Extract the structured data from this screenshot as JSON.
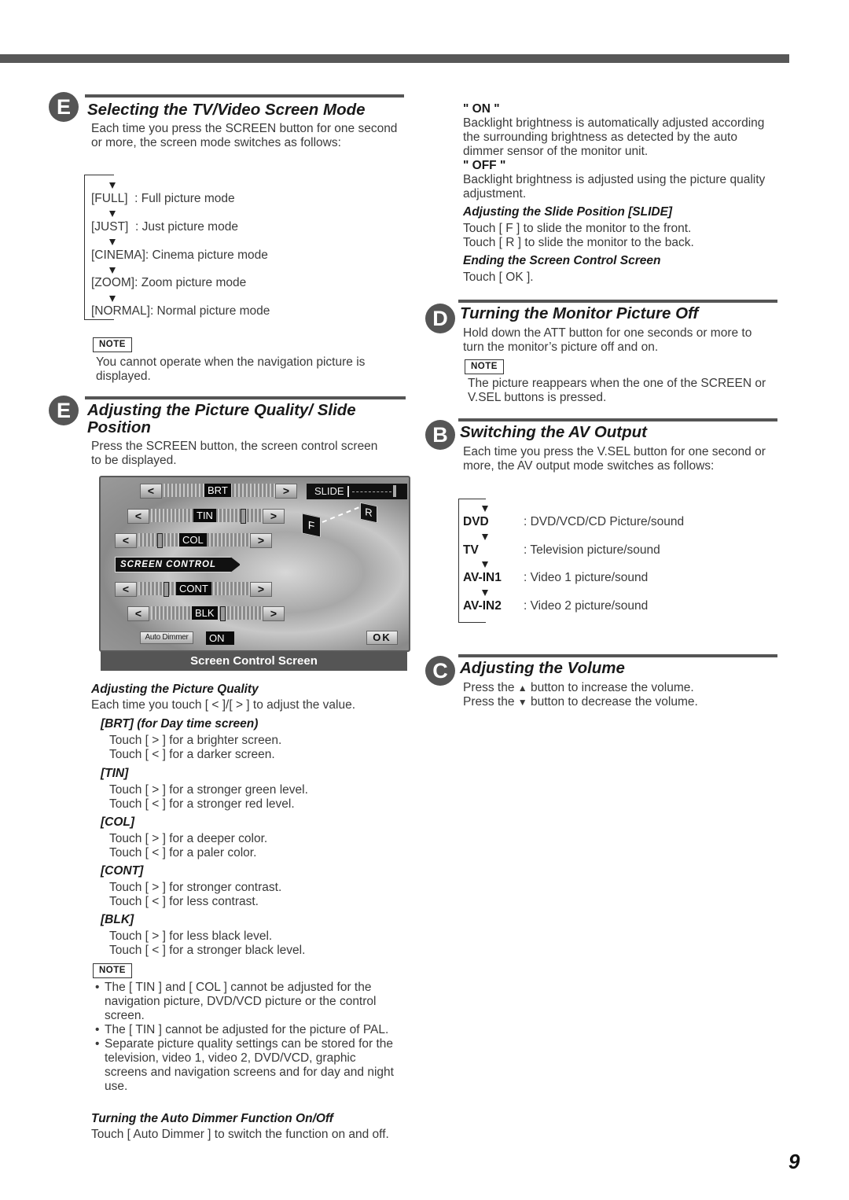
{
  "page_number": "9",
  "left": {
    "section1": {
      "badge": "E",
      "title": "Selecting the TV/Video Screen Mode",
      "intro": "Each time you press the SCREEN button for one second or more, the screen mode switches as follows:",
      "modes": [
        {
          "key": "[FULL]",
          "desc": "  : Full picture mode"
        },
        {
          "key": "[JUST]",
          "desc": "  : Just picture mode"
        },
        {
          "key": "[CINEMA]",
          "desc": ": Cinema picture mode"
        },
        {
          "key": "[ZOOM]",
          "desc": ": Zoom picture mode"
        },
        {
          "key": "[NORMAL]",
          "desc": ": Normal picture mode"
        }
      ],
      "note_label": "NOTE",
      "note_text": "You cannot operate when the navigation picture is displayed."
    },
    "section2": {
      "badge": "E",
      "title_line1": "Adjusting the Picture Quality/ Slide",
      "title_line2": "Position",
      "intro": "Press the SCREEN button, the screen control screen to be displayed.",
      "screen": {
        "rows": [
          {
            "label": "BRT",
            "level": 0.5
          },
          {
            "label": "TIN",
            "level": 0.8
          },
          {
            "label": "COL",
            "level": 0.25
          },
          {
            "label": "CONT",
            "level": 0.35
          },
          {
            "label": "BLK",
            "level": 0.55
          }
        ],
        "less_btn": "<",
        "more_btn": ">",
        "banner": "SCREEN CONTROL",
        "slide_label": "SLIDE",
        "front_btn": "F",
        "rear_btn": "R",
        "auto_dimmer_btn": "Auto Dimmer",
        "auto_dimmer_value": "ON",
        "ok_btn": "OK",
        "caption": "Screen Control Screen"
      },
      "pq_title": "Adjusting the Picture Quality",
      "pq_intro": "Each time you touch [ < ]/[ > ] to adjust the value.",
      "params": [
        {
          "name": "[BRT] (for Day time screen)",
          "lines": [
            "Touch [ > ] for a brighter screen.",
            "Touch [ < ] for a darker screen."
          ]
        },
        {
          "name": "[TIN]",
          "lines": [
            "Touch [ > ] for a stronger green level.",
            "Touch [ < ] for a stronger red level."
          ]
        },
        {
          "name": "[COL]",
          "lines": [
            "Touch [ > ] for a deeper color.",
            "Touch [ < ] for a paler color."
          ]
        },
        {
          "name": "[CONT]",
          "lines": [
            "Touch [ > ] for stronger contrast.",
            "Touch [ < ] for less contrast."
          ]
        },
        {
          "name": "[BLK]",
          "lines": [
            "Touch [ > ] for less black level.",
            "Touch [ < ] for a stronger black level."
          ]
        }
      ],
      "note_label": "NOTE",
      "notes": [
        "The [ TIN ] and [ COL ] cannot be adjusted for the navigation picture, DVD/VCD picture or the control screen.",
        "The [ TIN ] cannot be adjusted for the picture of PAL.",
        "Separate picture quality settings can be stored for the television, video 1, video 2, DVD/VCD, graphic screens and navigation screens and for day and night use."
      ],
      "dimmer_title": "Turning the Auto Dimmer Function On/Off",
      "dimmer_text": "Touch [ Auto Dimmer ] to switch the function on and off."
    }
  },
  "right": {
    "on_label": "\" ON \"",
    "on_text": "Backlight brightness is automatically adjusted according the surrounding brightness as detected by the auto dimmer sensor of the monitor unit.",
    "off_label": "\" OFF \"",
    "off_text": "Backlight brightness is adjusted using the picture quality adjustment.",
    "slide_title": "Adjusting the Slide Position [SLIDE]",
    "slide_lines": [
      "Touch [ F ] to slide the monitor to the front.",
      "Touch [ R ] to slide the monitor to the back."
    ],
    "end_title": "Ending the Screen Control Screen",
    "end_text": "Touch [ OK ].",
    "section_d": {
      "badge": "D",
      "title": "Turning the Monitor Picture Off",
      "text": "Hold down the ATT button for one seconds or more to turn the monitor’s picture off and on.",
      "note_label": "NOTE",
      "note_text": "The picture reappears when the one of the SCREEN or V.SEL buttons is pressed."
    },
    "section_b": {
      "badge": "B",
      "title": "Switching the AV Output",
      "intro": "Each time you press the V.SEL button for one second or more, the AV output mode switches as follows:",
      "modes": [
        {
          "key": "DVD",
          "desc": ": DVD/VCD/CD Picture/sound"
        },
        {
          "key": "TV",
          "desc": ": Television picture/sound"
        },
        {
          "key": "AV-IN1",
          "desc": ": Video 1 picture/sound"
        },
        {
          "key": "AV-IN2",
          "desc": ": Video 2 picture/sound"
        }
      ]
    },
    "section_c": {
      "badge": "C",
      "title": "Adjusting the Volume",
      "line1_pre": "Press the",
      "line1_post": "button to increase the volume.",
      "line2_pre": "Press the",
      "line2_post": "button to decrease the volume."
    }
  }
}
